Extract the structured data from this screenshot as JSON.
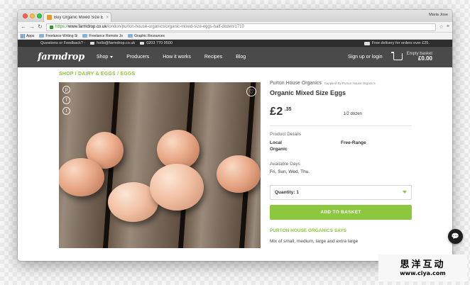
{
  "browser": {
    "tab_title": "Buy Organic Mixed Size Eggs",
    "tab_close": "×",
    "user": "Maria Jose",
    "url_https": "https://",
    "url_host": "www.farmdrop.co.uk",
    "url_path": "/london/purton-house-organics/organic-mixed-size-eggs-half-dozen/1710",
    "back_glyph": "←",
    "forward_glyph": "→",
    "reload_glyph": "↻",
    "star_glyph": "☆",
    "menu_glyph": "≡",
    "bookmarks": [
      {
        "label": "Apps"
      },
      {
        "label": "Freelance Writing Si"
      },
      {
        "label": "Freelance Remote Jo"
      },
      {
        "label": "Graphic Resources"
      }
    ]
  },
  "utility": {
    "questions": "Questions or Feedback? -",
    "email": "hello@farmdrop.co.uk",
    "phone": "0203 770 9500",
    "delivery": "Free delivery for orders over £25."
  },
  "nav": {
    "logo": "farmdrop",
    "items": [
      {
        "label": "Shop"
      },
      {
        "label": "Producers"
      },
      {
        "label": "How it works"
      },
      {
        "label": "Recipes"
      },
      {
        "label": "Blog"
      }
    ],
    "login": "Sign up or login",
    "basket_label": "Empty basket",
    "basket_total": "£0.00"
  },
  "breadcrumb": "SHOP / DAIRY & EGGS / EGGS",
  "share": {
    "pinterest": "p",
    "facebook": "f",
    "twitter": "t",
    "heart": "♡"
  },
  "product": {
    "supplier": "Purton House Organics",
    "supplied_by": "Supplied By Purton House Organics",
    "title": "Organic Mixed Size Eggs",
    "price_main": "£2",
    "price_pence": ".35",
    "size": "1/2 dozen",
    "details_label": "Product Details",
    "details_col1": [
      "Local",
      "Organic"
    ],
    "details_col2": [
      "Free-Range"
    ],
    "available_label": "Available Days",
    "available_days": "Fri, Sun, Wed, Thu.",
    "quantity": "Quantity: 1",
    "add_button": "ADD TO BASKET",
    "says_heading": "PURTON HOUSE ORGANICS SAYS",
    "description": "Mix of small, medium, large and extra large"
  },
  "chat_glyph": "💬",
  "watermark": {
    "cn": "思洋互动",
    "url": "www.ciya.com"
  },
  "colors": {
    "accent": "#8dc63f",
    "nav_bg": "#4a4a4a",
    "util_bg": "#2d2d2d"
  }
}
